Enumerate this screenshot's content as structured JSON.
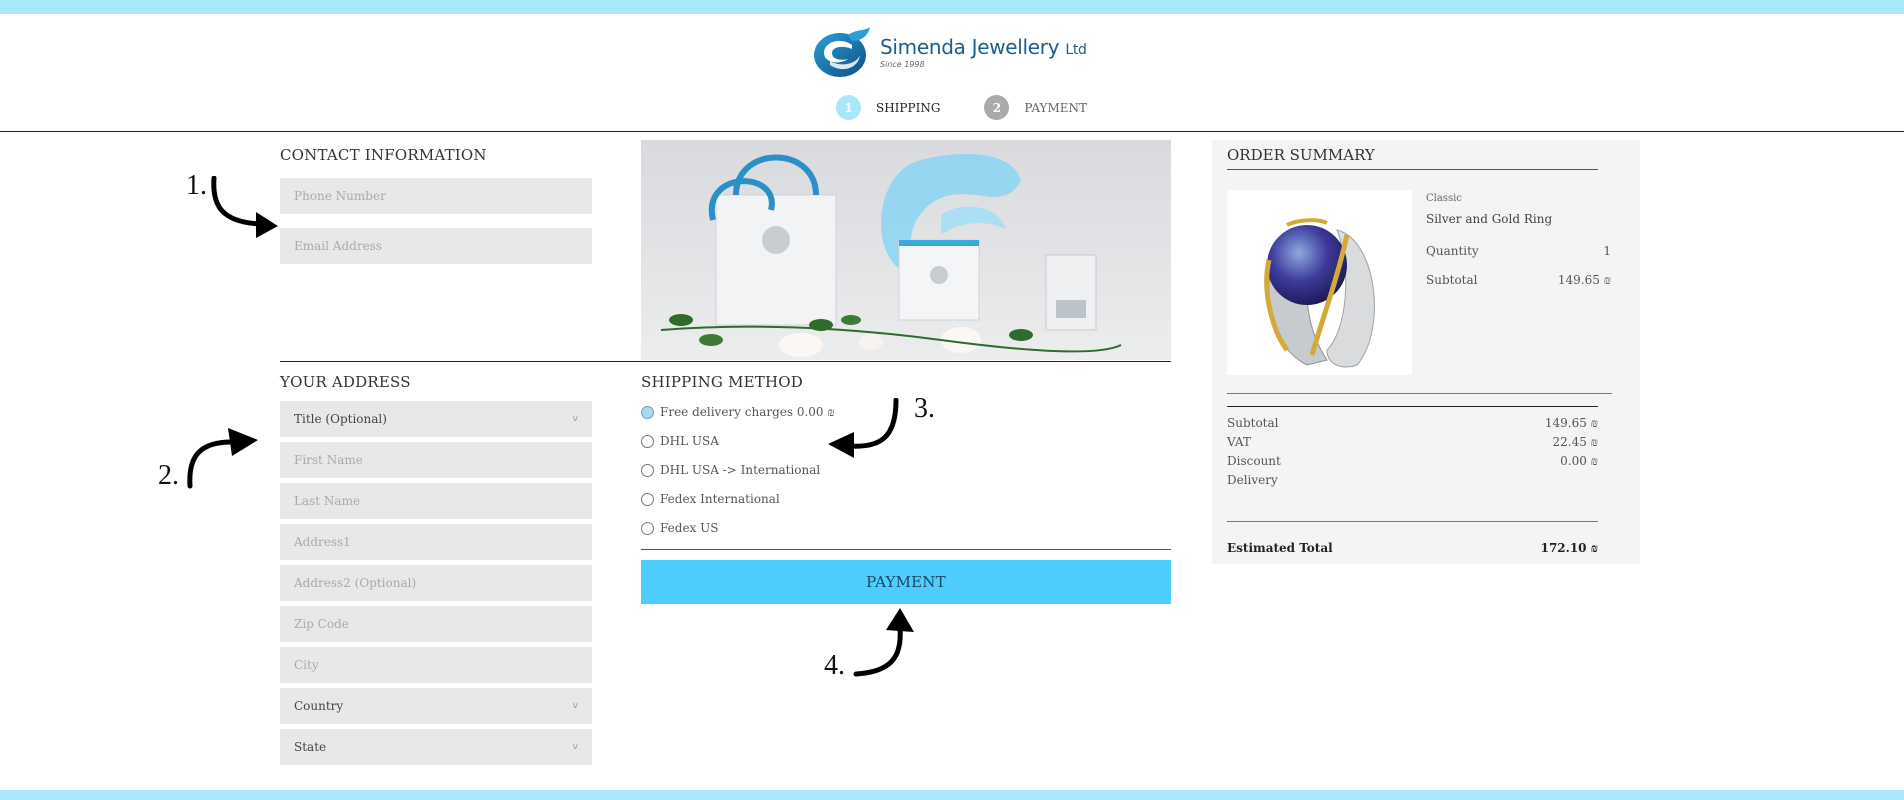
{
  "brand": {
    "name": "Simenda Jewellery",
    "suffix": "Ltd",
    "since": "Since 1998",
    "colors": {
      "primary": "#1d5d8f",
      "accent": "#4ecdfd",
      "bar": "#a9e8f8"
    }
  },
  "steps": [
    {
      "num": "1",
      "label": "SHIPPING",
      "active": true
    },
    {
      "num": "2",
      "label": "PAYMENT",
      "active": false
    }
  ],
  "contact": {
    "title": "CONTACT INFORMATION",
    "phone_placeholder": "Phone Number",
    "email_placeholder": "Email Address"
  },
  "address": {
    "title": "YOUR ADDRESS",
    "title_select": "Title (Optional)",
    "first_name_placeholder": "First Name",
    "last_name_placeholder": "Last Name",
    "address1_placeholder": "Address1",
    "address2_placeholder": "Address2 (Optional)",
    "zip_placeholder": "Zip Code",
    "city_placeholder": "City",
    "country_select": "Country",
    "state_select": "State",
    "chevron": "v"
  },
  "shipping": {
    "title": "SHIPPING METHOD",
    "options": [
      {
        "label": "Free delivery charges 0.00 ₪",
        "checked": true
      },
      {
        "label": "DHL USA",
        "checked": false
      },
      {
        "label": "DHL USA -> International",
        "checked": false
      },
      {
        "label": "Fedex International",
        "checked": false
      },
      {
        "label": "Fedex US",
        "checked": false
      }
    ]
  },
  "payment_button": "PAYMENT",
  "annotations": [
    "1.",
    "2.",
    "3.",
    "4."
  ],
  "banner": {
    "alt": "Simenda Jewellery gift bag, certificate and ring box with white roses"
  },
  "summary": {
    "title": "ORDER SUMMARY",
    "product": {
      "category": "Classic",
      "name": "Silver and Gold Ring",
      "quantity_label": "Quantity",
      "quantity": "1",
      "subtotal_label": "Subtotal",
      "subtotal": "149.65 ₪"
    },
    "totals": [
      {
        "label": "Subtotal",
        "value": "149.65 ₪"
      },
      {
        "label": "VAT",
        "value": "22.45 ₪"
      },
      {
        "label": "Discount",
        "value": "0.00 ₪"
      },
      {
        "label": "Delivery",
        "value": ""
      }
    ],
    "estimated_label": "Estimated Total",
    "estimated_value": "172.10 ₪"
  }
}
